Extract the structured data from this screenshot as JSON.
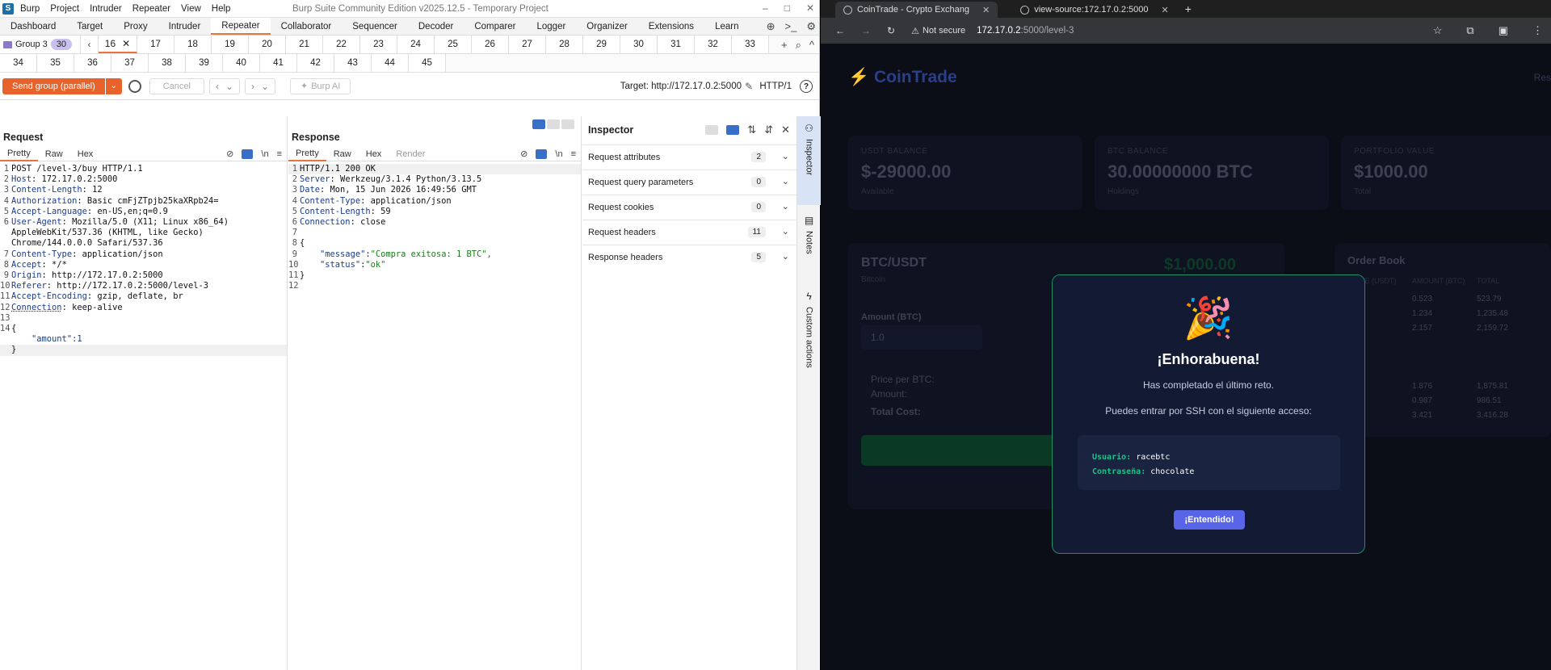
{
  "burp": {
    "menu": [
      "Burp",
      "Project",
      "Intruder",
      "Repeater",
      "View",
      "Help"
    ],
    "window_title": "Burp Suite Community Edition v2025.12.5 - Temporary Project",
    "window_controls": [
      "–",
      "□",
      "✕"
    ],
    "nav_tabs": [
      "Dashboard",
      "Target",
      "Proxy",
      "Intruder",
      "Repeater",
      "Collaborator",
      "Sequencer",
      "Decoder",
      "Comparer",
      "Logger",
      "Organizer",
      "Extensions",
      "Learn"
    ],
    "nav_active": "Repeater",
    "group_label": "Group 3",
    "group_count": "30",
    "selected_tab": "16",
    "tabs_row1": [
      "17",
      "18",
      "19",
      "20",
      "21",
      "22",
      "23",
      "24",
      "25",
      "26",
      "27",
      "28",
      "29",
      "30",
      "31",
      "32",
      "33"
    ],
    "tabs_row2": [
      "34",
      "35",
      "36",
      "37",
      "38",
      "39",
      "40",
      "41",
      "42",
      "43",
      "44",
      "45"
    ],
    "toolbar": {
      "send_label": "Send group (parallel)",
      "cancel_label": "Cancel",
      "burp_ai_label": "Burp AI",
      "target": "Target: http://172.17.0.2:5000",
      "http_version": "HTTP/1"
    },
    "request": {
      "title": "Request",
      "subtabs": [
        "Pretty",
        "Raw",
        "Hex"
      ],
      "lines": [
        {
          "n": "1",
          "name": "",
          "value": "POST /level-3/buy HTTP/1.1"
        },
        {
          "n": "2",
          "name": "Host",
          "value": ": 172.17.0.2:5000"
        },
        {
          "n": "3",
          "name": "Content-Length",
          "value": ": 12"
        },
        {
          "n": "4",
          "name": "Authorization",
          "value": ": Basic cmFjZTpjb25kaXRpb24="
        },
        {
          "n": "5",
          "name": "Accept-Language",
          "value": ": en-US,en;q=0.9"
        },
        {
          "n": "6",
          "name": "User-Agent",
          "value": ": Mozilla/5.0 (X11; Linux x86_64)"
        },
        {
          "n": "",
          "name": "",
          "value": "AppleWebKit/537.36 (KHTML, like Gecko)"
        },
        {
          "n": "",
          "name": "",
          "value": "Chrome/144.0.0.0 Safari/537.36"
        },
        {
          "n": "7",
          "name": "Content-Type",
          "value": ": application/json"
        },
        {
          "n": "8",
          "name": "Accept",
          "value": ": */*"
        },
        {
          "n": "9",
          "name": "Origin",
          "value": ": http://172.17.0.2:5000"
        },
        {
          "n": "10",
          "name": "Referer",
          "value": ": http://172.17.0.2:5000/level-3"
        },
        {
          "n": "11",
          "name": "Accept-Encoding",
          "value": ": gzip, deflate, br"
        },
        {
          "n": "12",
          "name": "Connection",
          "value": ": keep-alive"
        },
        {
          "n": "13",
          "name": "",
          "value": ""
        },
        {
          "n": "14",
          "name": "",
          "value": "{"
        },
        {
          "n": "",
          "name": "",
          "value": "    \"amount\":1",
          "json": true
        },
        {
          "n": "",
          "name": "",
          "value": "}"
        }
      ]
    },
    "response": {
      "title": "Response",
      "subtabs": [
        "Pretty",
        "Raw",
        "Hex",
        "Render"
      ],
      "lines": [
        {
          "n": "1",
          "name": "",
          "value": "HTTP/1.1 200 OK"
        },
        {
          "n": "2",
          "name": "Server",
          "value": ": Werkzeug/3.1.4 Python/3.13.5"
        },
        {
          "n": "3",
          "name": "Date",
          "value": ": Mon, 15 Jun 2026 16:49:56 GMT"
        },
        {
          "n": "4",
          "name": "Content-Type",
          "value": ": application/json"
        },
        {
          "n": "5",
          "name": "Content-Length",
          "value": ": 59"
        },
        {
          "n": "6",
          "name": "Connection",
          "value": ": close"
        },
        {
          "n": "7",
          "name": "",
          "value": ""
        },
        {
          "n": "8",
          "name": "",
          "value": "{"
        },
        {
          "n": "9",
          "name": "",
          "key": "\"message\"",
          "value": "\"Compra exitosa: 1 BTC\",",
          "json": true
        },
        {
          "n": "10",
          "name": "",
          "key": "\"status\"",
          "value": "\"ok\"",
          "json": true
        },
        {
          "n": "11",
          "name": "",
          "value": "}"
        },
        {
          "n": "12",
          "name": "",
          "value": ""
        }
      ]
    },
    "inspector": {
      "title": "Inspector",
      "sections": [
        {
          "label": "Request attributes",
          "count": "2"
        },
        {
          "label": "Request query parameters",
          "count": "0"
        },
        {
          "label": "Request cookies",
          "count": "0"
        },
        {
          "label": "Request headers",
          "count": "11"
        },
        {
          "label": "Response headers",
          "count": "5"
        }
      ]
    },
    "sidebar": [
      "Inspector",
      "Notes",
      "Custom actions"
    ]
  },
  "browser": {
    "tabs": [
      {
        "title": "CoinTrade - Crypto Exchang",
        "active": true
      },
      {
        "title": "view-source:172.17.0.2:5000",
        "active": false
      }
    ],
    "not_secure": "Not secure",
    "url_host": "172.17.0.2",
    "url_rest": ":5000/level-3",
    "page": {
      "brand": "⚡ CoinTrade",
      "top_right": "Res",
      "cards": [
        {
          "label": "USDT BALANCE",
          "value": "$-29000.00",
          "sub": "Available"
        },
        {
          "label": "BTC BALANCE",
          "value": "30.00000000 BTC",
          "sub": "Holdings"
        },
        {
          "label": "PORTFOLIO VALUE",
          "value": "$1000.00",
          "sub": "Total"
        }
      ],
      "pair": "BTC/USDT",
      "pair_sub": "Bitcoin",
      "price": "$1,000.00",
      "amount_label": "Amount (BTC)",
      "amount_value": "1.0",
      "price_per": "Price per BTC:",
      "amount_row": "Amount:",
      "total_cost": "Total Cost:",
      "order_book_title": "Order Book",
      "order_book_headers": [
        "PRICE (USDT)",
        "AMOUNT (BTC)",
        "TOTAL"
      ],
      "order_book_rows": [
        [
          "",
          "0.523",
          "523.79"
        ],
        [
          "",
          "1.234",
          "1,235.48"
        ],
        [
          "",
          "2.157",
          "2,159.72"
        ],
        [
          "",
          "1.876",
          "1,875.81"
        ],
        [
          "",
          "0.987",
          "986.51"
        ],
        [
          "",
          "3.421",
          "3,416.28"
        ]
      ],
      "modal": {
        "emoji": "🎉",
        "title": "¡Enhorabuena!",
        "p1": "Has completado el último reto.",
        "p2": "Puedes entrar por SSH con el siguiente acceso:",
        "user_label": "Usuario:",
        "user": "racebtc",
        "pass_label": "Contraseña:",
        "pass": "chocolate",
        "button": "¡Entendido!"
      }
    }
  }
}
